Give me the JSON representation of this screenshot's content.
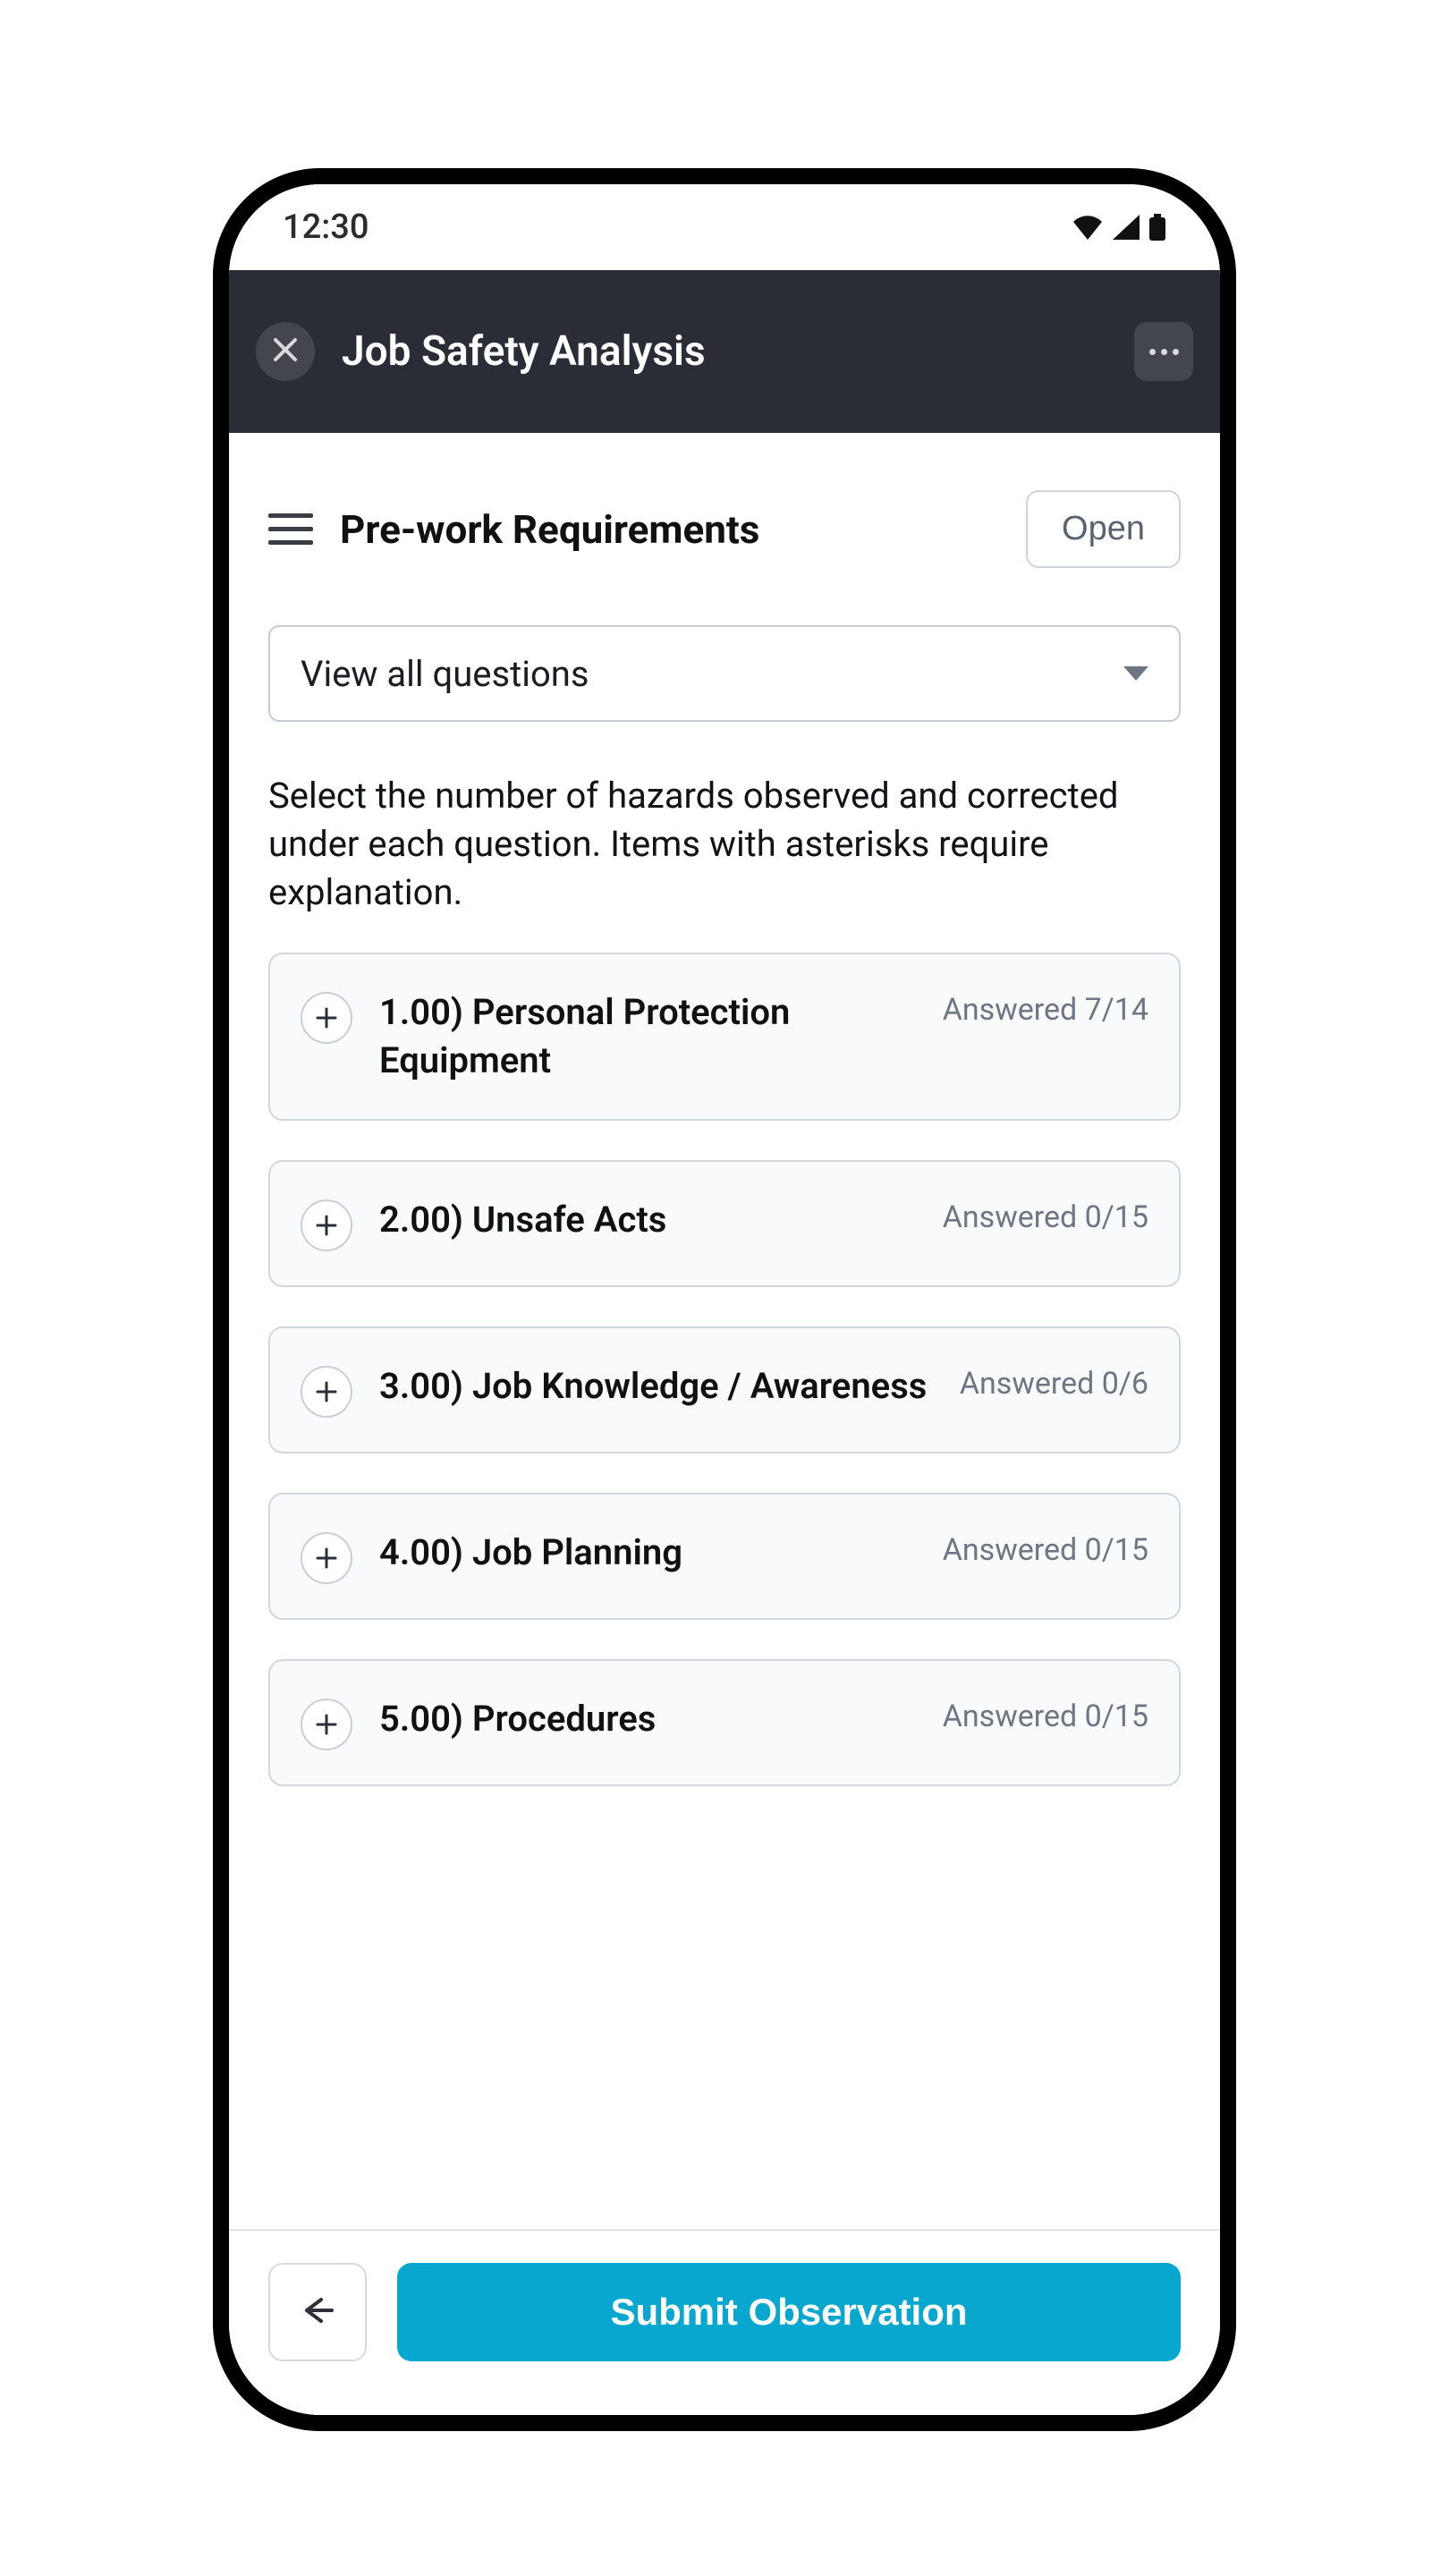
{
  "status": {
    "time": "12:30"
  },
  "appbar": {
    "title": "Job Safety Analysis"
  },
  "section": {
    "title": "Pre-work Requirements",
    "open_label": "Open"
  },
  "dropdown": {
    "selected": "View all questions"
  },
  "instruction": "Select the number of hazards observed and corrected under each question. Items with asterisks require explanation.",
  "items": [
    {
      "title": "1.00) Personal Protection Equipment",
      "status": "Answered 7/14"
    },
    {
      "title": "2.00) Unsafe Acts",
      "status": "Answered 0/15"
    },
    {
      "title": "3.00) Job Knowledge / Awareness",
      "status": "Answered 0/6"
    },
    {
      "title": "4.00) Job Planning",
      "status": "Answered 0/15"
    },
    {
      "title": "5.00) Procedures",
      "status": "Answered 0/15"
    }
  ],
  "footer": {
    "submit_label": "Submit Observation"
  }
}
